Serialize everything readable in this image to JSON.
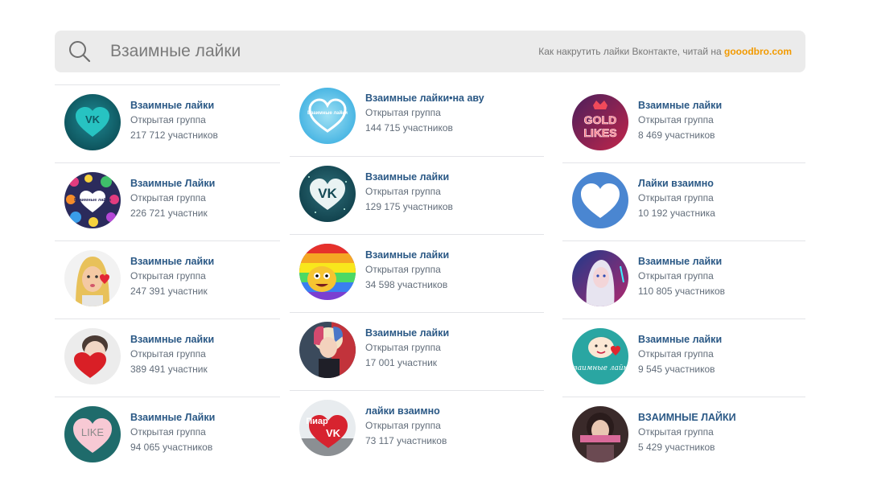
{
  "search": {
    "query": "Взаимные лайки",
    "promo_text": "Как накрутить лайки Вконтакте, читай на ",
    "promo_link": "gooodbro.com"
  },
  "colors": {
    "link": "#2a5885",
    "promo": "#f29a00",
    "meta": "#626d7a"
  },
  "columns": [
    [
      {
        "name": "Взаимные лайки",
        "type": "Открытая группа",
        "members": "217 712 участников",
        "avatar_icon": "vk-heart-logo"
      },
      {
        "name": "Взаимные Лайки",
        "type": "Открытая группа",
        "members": "226 721 участник",
        "avatar_icon": "heart-sticker-collage"
      },
      {
        "name": "Взаимные лайки",
        "type": "Открытая группа",
        "members": "247 391 участник",
        "avatar_icon": "memoji-with-heart"
      },
      {
        "name": "Взаимные лайки",
        "type": "Открытая группа",
        "members": "389 491 участник",
        "avatar_icon": "child-with-red-heart"
      },
      {
        "name": "Взаимные Лайки",
        "type": "Открытая группа",
        "members": "94 065 участников",
        "avatar_icon": "pink-like-heart"
      }
    ],
    [
      {
        "name": "Взаимные лайки•на аву",
        "type": "Открытая группа",
        "members": "144 715 участников",
        "avatar_icon": "blue-heart"
      },
      {
        "name": "Взаимные лайки",
        "type": "Открытая группа",
        "members": "129 175 участников",
        "avatar_icon": "vk-heart-logo-dark"
      },
      {
        "name": "Взаимные лайки",
        "type": "Открытая группа",
        "members": "34 598 участников",
        "avatar_icon": "cartoon-rainbow"
      },
      {
        "name": "Взаимные лайки",
        "type": "Открытая группа",
        "members": "17 001 участник",
        "avatar_icon": "character-portrait"
      },
      {
        "name": "лайки взаимно",
        "type": "Открытая группа",
        "members": "73 117 участников",
        "avatar_icon": "piar-vk-heart"
      }
    ],
    [
      {
        "name": "Взаимные лайки",
        "type": "Открытая группа",
        "members": "8 469 участников",
        "avatar_icon": "gold-likes-crown"
      },
      {
        "name": "Лайки взаимно",
        "type": "Открытая группа",
        "members": "10 192 участника",
        "avatar_icon": "white-heart-blue"
      },
      {
        "name": "Взаимные лайки",
        "type": "Открытая группа",
        "members": "110 805 участников",
        "avatar_icon": "neon-portrait"
      },
      {
        "name": "Взаимные лайки",
        "type": "Открытая группа",
        "members": "9 545 участников",
        "avatar_icon": "cartoon-vzaimnye-laiki"
      },
      {
        "name": "ВЗАИМНЫЕ ЛАЙКИ",
        "type": "Открытая группа",
        "members": "5 429 участников",
        "avatar_icon": "photo-portrait"
      }
    ]
  ],
  "avatar_text": {
    "vzaimnye_laiki": "Взаимные лайки",
    "gold": "GOLD",
    "likes": "LIKES",
    "like": "LIKE",
    "piar": "Пиар",
    "vk": "VK"
  }
}
